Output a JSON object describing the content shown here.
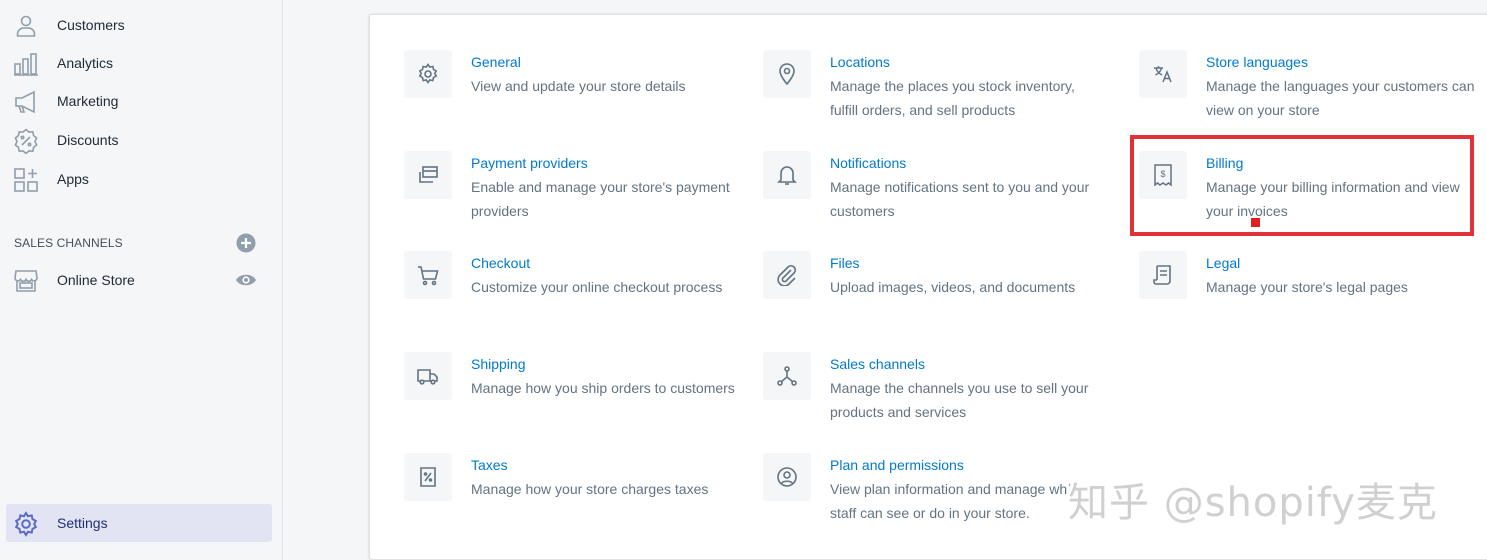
{
  "sidebar": {
    "items": [
      {
        "label": "Customers",
        "icon": "customers-icon"
      },
      {
        "label": "Analytics",
        "icon": "analytics-icon"
      },
      {
        "label": "Marketing",
        "icon": "marketing-icon"
      },
      {
        "label": "Discounts",
        "icon": "discounts-icon"
      },
      {
        "label": "Apps",
        "icon": "apps-icon"
      }
    ],
    "sales_channels_heading": "SALES CHANNELS",
    "online_store_label": "Online Store",
    "settings_label": "Settings"
  },
  "settings": [
    {
      "title": "General",
      "description": "View and update your store details",
      "icon": "gear-icon"
    },
    {
      "title": "Locations",
      "description": "Manage the places you stock inventory, fulfill orders, and sell products",
      "icon": "location-pin-icon"
    },
    {
      "title": "Store languages",
      "description": "Manage the languages your customers can view on your store",
      "icon": "translate-icon"
    },
    {
      "title": "Payment providers",
      "description": "Enable and manage your store's payment providers",
      "icon": "payment-icon"
    },
    {
      "title": "Notifications",
      "description": "Manage notifications sent to you and your customers",
      "icon": "bell-icon"
    },
    {
      "title": "Billing",
      "description": "Manage your billing information and view your invoices",
      "icon": "billing-icon"
    },
    {
      "title": "Checkout",
      "description": "Customize your online checkout process",
      "icon": "cart-icon"
    },
    {
      "title": "Files",
      "description": "Upload images, videos, and documents",
      "icon": "paperclip-icon"
    },
    {
      "title": "Legal",
      "description": "Manage your store's legal pages",
      "icon": "legal-icon"
    },
    {
      "title": "Shipping",
      "description": "Manage how you ship orders to customers",
      "icon": "truck-icon"
    },
    {
      "title": "Sales channels",
      "description": "Manage the channels you use to sell your products and services",
      "icon": "sales-channels-icon"
    },
    {
      "title": "Taxes",
      "description": "Manage how your store charges taxes",
      "icon": "tax-icon"
    },
    {
      "title": "Plan and permissions",
      "description": "View plan information and manage whʿ staff can see or do in your store.",
      "icon": "user-circle-icon"
    }
  ],
  "watermark": "知乎 @shopify麦克",
  "colors": {
    "link": "#007ace",
    "muted_text": "#637381",
    "highlight": "#e03236",
    "active_nav_bg": "#e2e4f3",
    "icon": "#637381"
  }
}
